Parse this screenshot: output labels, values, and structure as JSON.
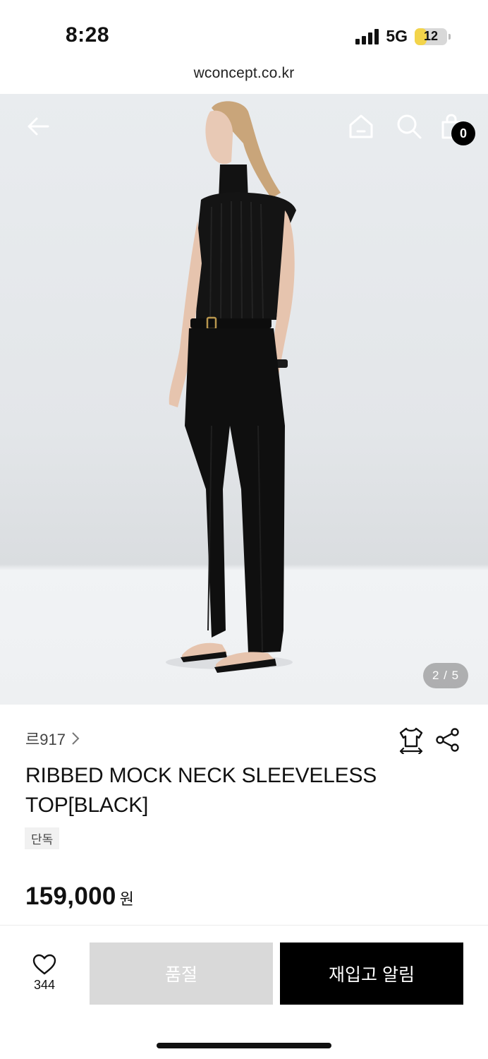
{
  "status_bar": {
    "time": "8:28",
    "network": "5G",
    "battery_level": "12",
    "battery_fraction": 0.12
  },
  "browser": {
    "url": "wconcept.co.kr"
  },
  "header": {
    "back_icon": "arrow-left-icon",
    "home_icon": "home-icon",
    "search_icon": "search-icon",
    "cart_icon": "shopping-bag-icon",
    "cart_count": "0"
  },
  "gallery": {
    "counter": "2 / 5",
    "current": 2,
    "total": 5
  },
  "product": {
    "brand": "르917",
    "title": "RIBBED MOCK NECK SLEEVELESS TOP[BLACK]",
    "badge": "단독",
    "price": "159,000",
    "currency": "원"
  },
  "actions": {
    "wish_count": "344",
    "soldout_label": "품절",
    "restock_label": "재입고 알림"
  },
  "colors": {
    "primary": "#000000",
    "disabled": "#d9d9d9",
    "badge_bg": "#f1f1f1"
  }
}
